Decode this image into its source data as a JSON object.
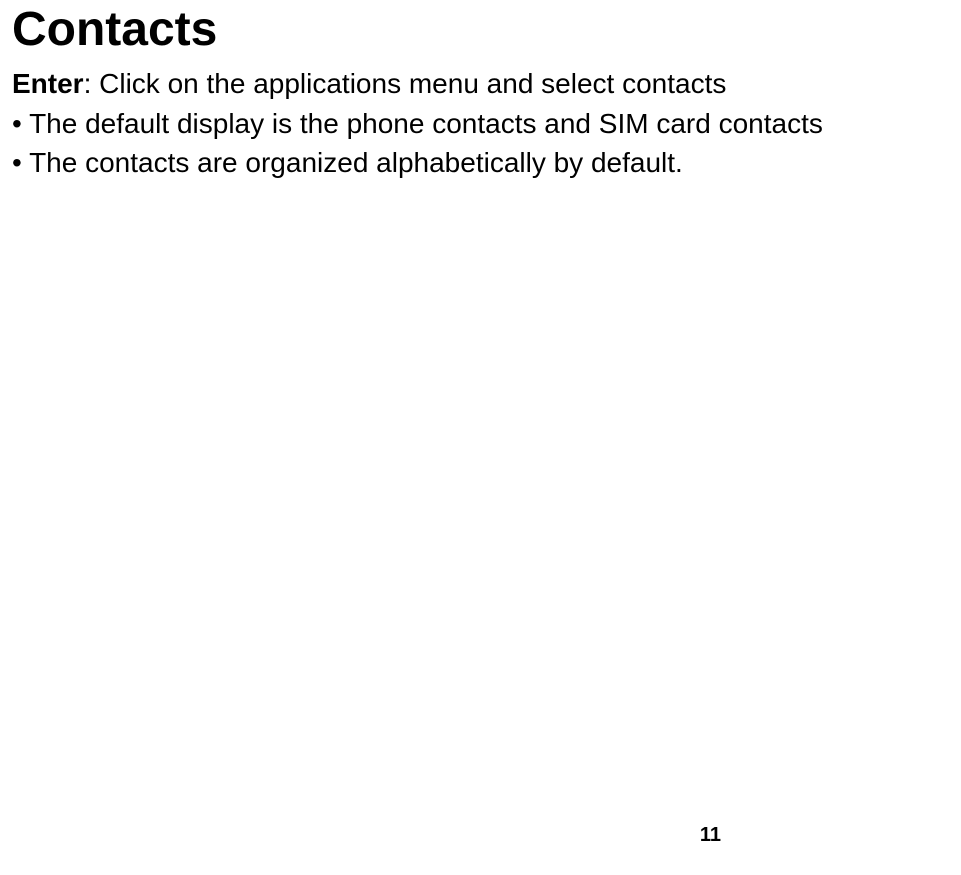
{
  "heading": "Contacts",
  "line1_bold": "Enter",
  "line1_rest": ": Click on the applications menu and select contacts",
  "bullet1": "• The default display is the phone contacts and SIM card contacts",
  "bullet2": "• The contacts are organized alphabetically by default.",
  "page_number": "11"
}
